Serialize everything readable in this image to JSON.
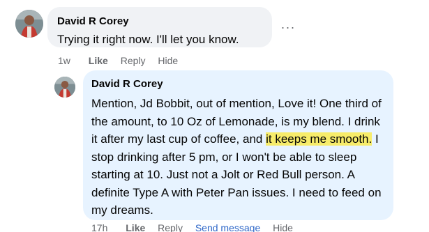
{
  "comments": [
    {
      "author": "David R Corey",
      "text": "Trying it right now. I'll let you know.",
      "time": "1w",
      "actions": {
        "like": "Like",
        "reply": "Reply",
        "hide": "Hide"
      },
      "more_label": "···"
    },
    {
      "author": "David R Corey",
      "text_before": "Mention, Jd Bobbit, out of mention, Love it! One third of the amount, to 10 Oz of Lemonade, is my blend. I drink it after my last cup of coffee, and ",
      "text_highlight": "it keeps me smooth.",
      "text_after": " I stop drinking after 5 pm, or I won't be able to sleep starting at 10. Just not a Jolt or Red Bull person. A definite Type A with Peter Pan issues. I need to feed on my dreams.",
      "time": "17h",
      "actions": {
        "like": "Like",
        "reply": "Reply",
        "send_message": "Send message",
        "hide": "Hide"
      }
    }
  ],
  "colors": {
    "bubble_gray": "#f0f2f5",
    "bubble_blue": "#e7f3ff",
    "highlight": "#f7ec6a",
    "secondary_text": "#65676b",
    "link_blue": "#2e67c8"
  }
}
